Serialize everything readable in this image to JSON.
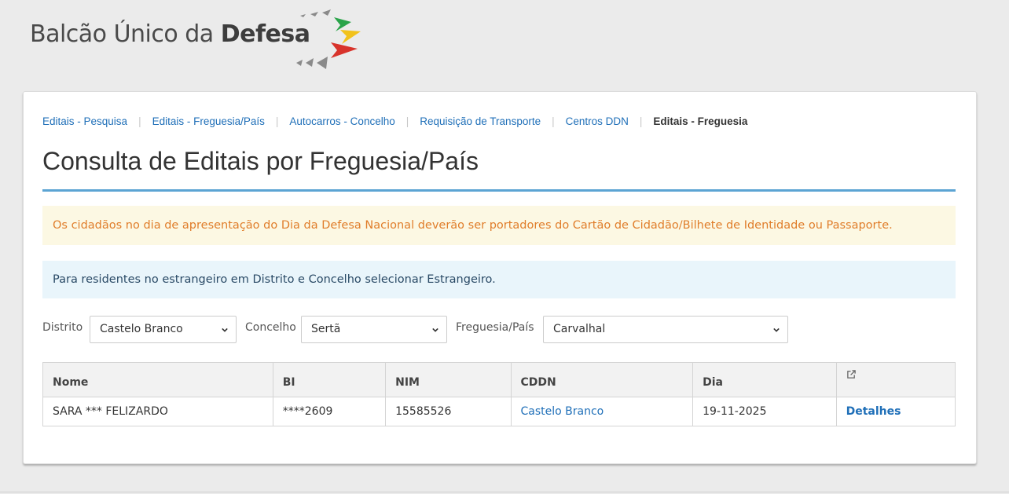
{
  "header": {
    "logo_text_regular": "Balcão Único da ",
    "logo_text_bold": "Defesa"
  },
  "breadcrumb": {
    "items": [
      "Editais - Pesquisa",
      "Editais - Freguesia/País",
      "Autocarros - Concelho",
      "Requisição de Transporte",
      "Centros DDN"
    ],
    "current": "Editais - Freguesia"
  },
  "page": {
    "title": "Consulta de Editais por Freguesia/País"
  },
  "alerts": {
    "warning": "Os cidadãos no dia de apresentação do Dia da Defesa Nacional deverão ser portadores do Cartão de Cidadão/Bilhete de Identidade ou Passaporte.",
    "info": "Para residentes no estrangeiro em Distrito e Concelho selecionar Estrangeiro."
  },
  "filters": {
    "distrito_label": "Distrito",
    "distrito_value": "Castelo Branco",
    "concelho_label": "Concelho",
    "concelho_value": "Sertã",
    "freguesia_label": "Freguesia/País",
    "freguesia_value": "Carvalhal"
  },
  "table": {
    "headers": [
      "Nome",
      "BI",
      "NIM",
      "CDDN",
      "Dia"
    ],
    "rows": [
      {
        "nome": "SARA *** FELIZARDO",
        "bi": "****2609",
        "nim": "15585526",
        "cddn": "Castelo Branco",
        "dia": "19-11-2025",
        "link": "Detalhes"
      }
    ]
  },
  "colors": {
    "link": "#1f6fb8",
    "warning_text": "#e07d2a",
    "warning_bg": "#fcf8e3",
    "info_bg": "#e9f5fb",
    "title_rule": "#5ba4d3"
  },
  "icons": {
    "external_link": "external-link-icon",
    "select_chevron": "chevron-down-icon"
  }
}
